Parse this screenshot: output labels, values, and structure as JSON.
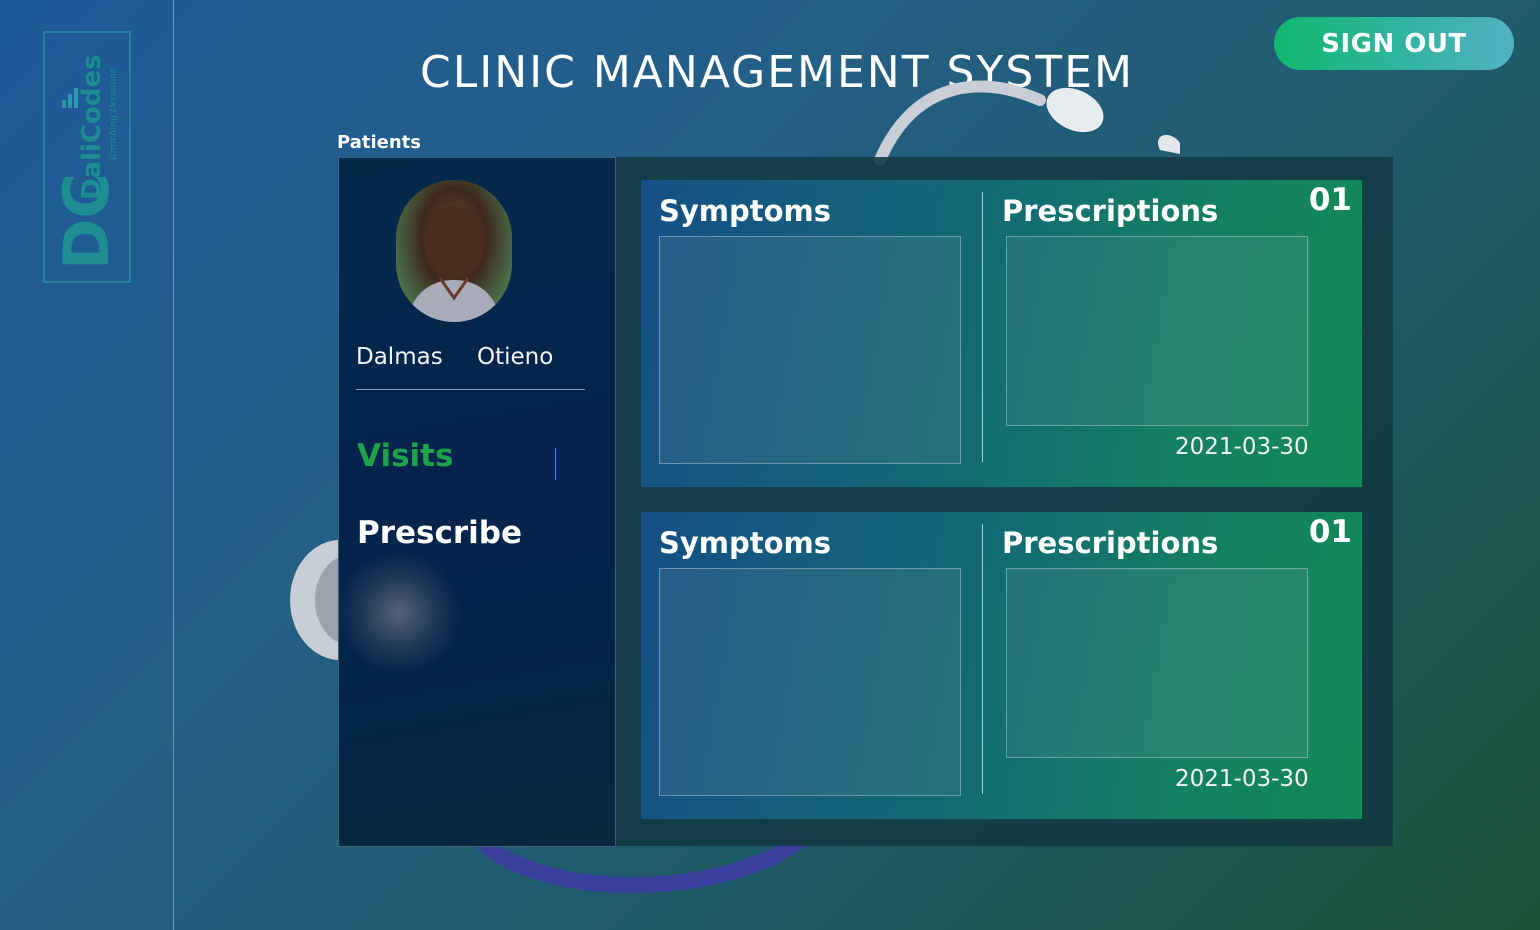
{
  "app": {
    "title": "CLINIC MANAGEMENT SYSTEM",
    "sign_out_label": "SIGN OUT"
  },
  "logo": {
    "initials": "DC",
    "brand": "DaliCodes",
    "tagline": "Enriching Decisions"
  },
  "patients": {
    "section_label": "Patients",
    "first_name": "Dalmas",
    "last_name": "Otieno"
  },
  "nav": {
    "visits_label": "Visits",
    "prescribe_label": "Prescribe"
  },
  "visits": [
    {
      "number": "01",
      "symptoms_label": "Symptoms",
      "prescriptions_label": "Prescriptions",
      "date": "2021-03-30"
    },
    {
      "number": "01",
      "symptoms_label": "Symptoms",
      "prescriptions_label": "Prescriptions",
      "date": "2021-03-30"
    }
  ],
  "colors": {
    "accent_green": "#1fa34a",
    "signout_start": "#10b86e",
    "signout_end": "#52b2c4"
  }
}
